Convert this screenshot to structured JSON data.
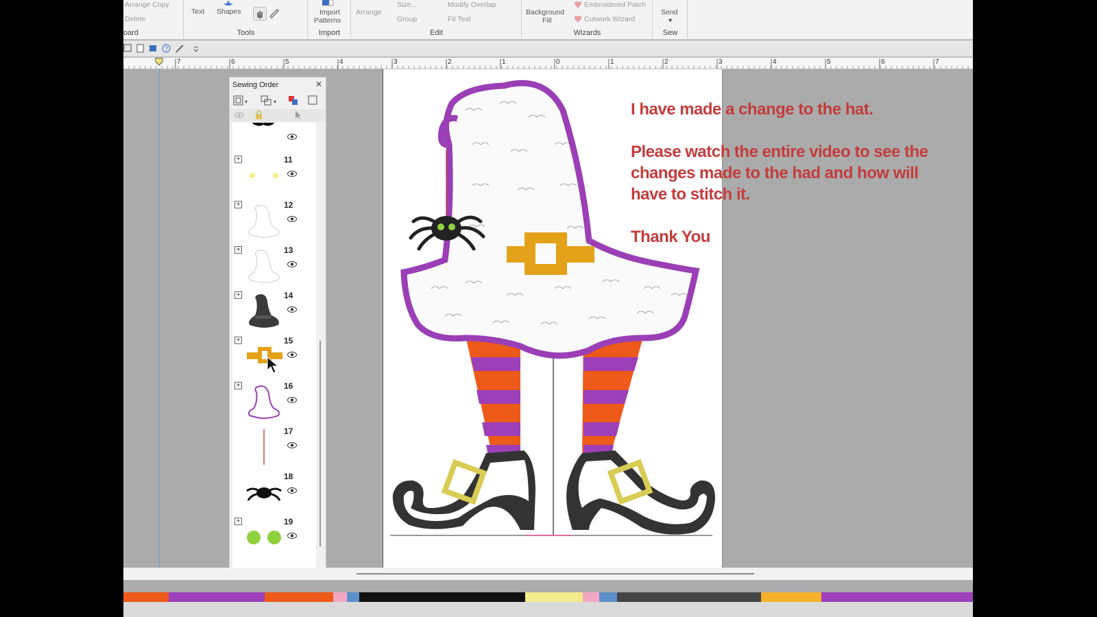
{
  "ribbon": {
    "clipboard": {
      "arrange_copy": "Arrange Copy",
      "delete": "Delete",
      "label": "oard"
    },
    "tools": {
      "text": "Text",
      "shapes": "Shapes",
      "label": "Tools"
    },
    "import": {
      "import_patterns_line1": "Import",
      "import_patterns_line2": "Patterns",
      "label": "Import"
    },
    "edit": {
      "arrange": "Arrange",
      "size": "Size...",
      "group": "Group",
      "modify_overlap": "Modify Overlap",
      "fit_text": "Fit Text",
      "label": "Edit"
    },
    "wizards": {
      "background_fill_line1": "Background",
      "background_fill_line2": "Fill",
      "embroidered_patch": "Embroidered Patch",
      "cutwork_wizard": "Cutwork Wizard",
      "label": "Wizards"
    },
    "sew": {
      "send": "Send",
      "label": "Sew"
    }
  },
  "ruler": {
    "labels": [
      "7",
      "6",
      "5",
      "4",
      "3",
      "2",
      "1",
      "0",
      "1",
      "2",
      "3",
      "4",
      "5",
      "6",
      "7"
    ]
  },
  "sewing_order": {
    "title": "Sewing Order",
    "items": [
      {
        "num": "",
        "icon": "mustache-icon",
        "expandable": false
      },
      {
        "num": "11",
        "icon": "yellow-dots-icon",
        "expandable": true
      },
      {
        "num": "12",
        "icon": "hat-outline-icon",
        "expandable": true
      },
      {
        "num": "13",
        "icon": "hat-outline-icon",
        "expandable": true
      },
      {
        "num": "14",
        "icon": "witch-hat-icon",
        "expandable": true
      },
      {
        "num": "15",
        "icon": "buckle-icon",
        "expandable": true
      },
      {
        "num": "16",
        "icon": "purple-hat-outline-icon",
        "expandable": true
      },
      {
        "num": "17",
        "icon": "thread-line-icon",
        "expandable": false
      },
      {
        "num": "18",
        "icon": "spider-icon",
        "expandable": false
      },
      {
        "num": "19",
        "icon": "green-dots-icon",
        "expandable": true
      }
    ]
  },
  "message": {
    "line1": "I have made a change to the hat.",
    "line2": "Please watch the entire video to see the changes made to the had and how will have to stitch it.",
    "line3": "Thank You"
  },
  "colors": {
    "message": "#c33c3c",
    "hat_outline": "#9a3fb5",
    "buckle": "#e3a21a",
    "stripe_orange": "#ee5a1a",
    "stripe_purple": "#9c3fb8",
    "boot": "#333333",
    "boot_buckle": "#d8cc55",
    "spider_eyes": "#8fd13f"
  },
  "colorbar": [
    {
      "color": "#ee5a1a",
      "w": 66
    },
    {
      "color": "#9c3fb8",
      "w": 140
    },
    {
      "color": "#ee5a1a",
      "w": 100
    },
    {
      "color": "#f3a7c3",
      "w": 20
    },
    {
      "color": "#5b8fc9",
      "w": 18
    },
    {
      "color": "#111111",
      "w": 242
    },
    {
      "color": "#f4ec88",
      "w": 84
    },
    {
      "color": "#f3a7c3",
      "w": 24
    },
    {
      "color": "#5b8fc9",
      "w": 26
    },
    {
      "color": "#444444",
      "w": 210
    },
    {
      "color": "#f5b22a",
      "w": 88
    },
    {
      "color": "#9c3fb8",
      "w": 221
    }
  ]
}
